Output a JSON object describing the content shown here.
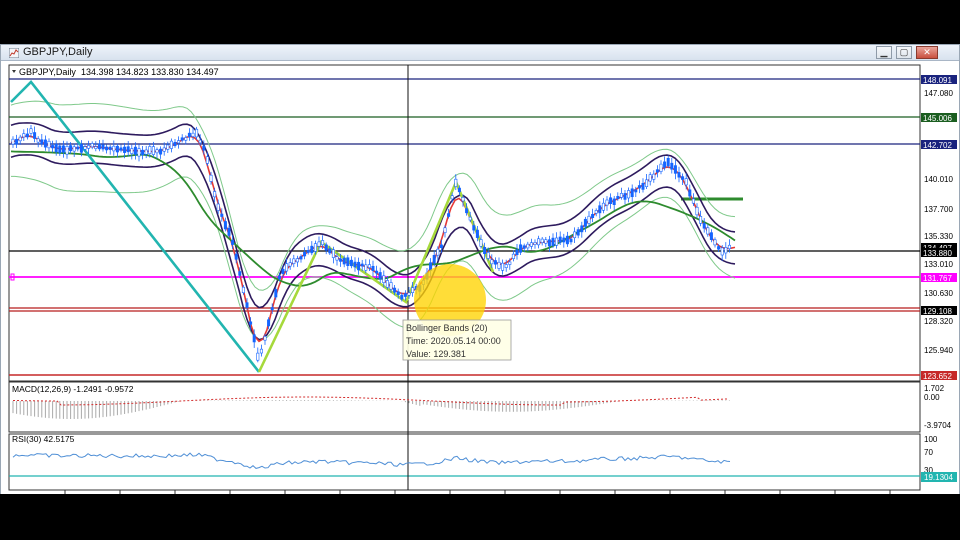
{
  "window": {
    "title": "GBPJPY,Daily",
    "buttons": [
      "minimize",
      "restore",
      "close"
    ]
  },
  "main_pane": {
    "header_symbol": "GBPJPY,Daily",
    "header_ohlc": "134.398 134.823 133.830 134.497",
    "price_labels": [
      "147.080",
      "137.700",
      "140.010",
      "135.330",
      "133.010",
      "130.630",
      "128.320",
      "125.940"
    ],
    "level_tags": [
      {
        "text": "148.091",
        "bg": "#1a237e"
      },
      {
        "text": "145.006",
        "bg": "#1b5e20"
      },
      {
        "text": "142.702",
        "bg": "#1a237e"
      },
      {
        "text": "134.497",
        "bg": "#000000"
      },
      {
        "text": "133.880",
        "bg": "#000000"
      },
      {
        "text": "131.767",
        "bg": "#ff00ff"
      },
      {
        "text": "129.108",
        "bg": "#000000"
      },
      {
        "text": "123.652",
        "bg": "#c62828"
      }
    ]
  },
  "tooltip": {
    "name": "Bollinger Bands (20)",
    "time": "Time: 2020.05.14 00:00",
    "value": "Value: 129.381"
  },
  "macd_pane": {
    "label": "MACD(12,26,9) -1.2491 -0.9572",
    "scale": [
      "1.702",
      "0.00",
      "-3.9704"
    ]
  },
  "rsi_pane": {
    "label": "RSI(30) 42.5175",
    "scale": [
      "100",
      "70",
      "30"
    ],
    "tag": "19.1304"
  },
  "colors": {
    "candle": "#1565ff",
    "bb_inner": "#2e1b5e",
    "bb_outer": "#7fc98a",
    "ma_red": "#e53935",
    "ma_green": "#2e8b2e",
    "zigzag": "#22b5b0",
    "zigzag_light": "#a6d93b",
    "highlight": "#ffd400",
    "macd_hist": "#a9a9a9",
    "macd_signal": "#d32f2f",
    "rsi_line": "#4f8fd6"
  }
}
